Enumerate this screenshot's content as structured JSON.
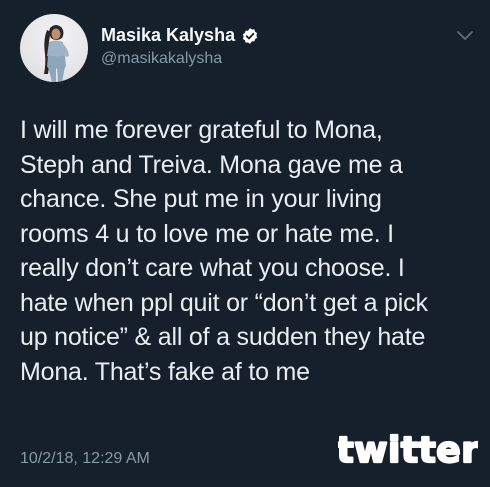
{
  "user": {
    "display_name": "Masika Kalysha",
    "handle": "@masikakalysha",
    "verified": true
  },
  "tweet": {
    "lines": [
      "I will me forever grateful to Mona,",
      "Steph and Treiva. Mona gave me a",
      "chance. She put me in your living",
      "rooms 4 u to love me or hate me. I",
      "really don’t care what you choose. I",
      "hate when ppl quit or “don’t get a pick",
      "up notice” & all of a sudden they hate",
      "Mona. That’s fake af to me"
    ],
    "timestamp": "10/2/18, 12:29 AM"
  },
  "watermark": {
    "text": "twitter"
  },
  "icons": {
    "verified": "verified-badge-icon",
    "menu": "chevron-down-icon"
  },
  "colors": {
    "background": "#16202b",
    "text": "#e8edf1",
    "secondary": "#8899a6",
    "watermark": "#ffffff"
  }
}
